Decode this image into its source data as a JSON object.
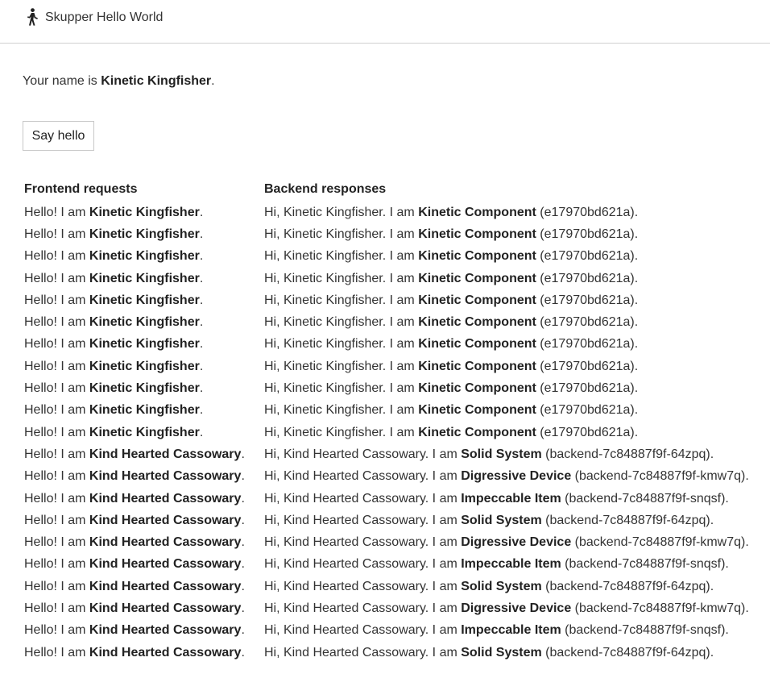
{
  "header": {
    "title": "Skupper Hello World",
    "logo_icon": "person-walking-icon"
  },
  "name_line": {
    "prefix": "Your name is ",
    "name": "Kinetic Kingfisher",
    "suffix": "."
  },
  "say_hello_label": "Say hello",
  "table": {
    "frontend_header": "Frontend requests",
    "backend_header": "Backend responses",
    "rows": [
      {
        "req_prefix": "Hello! I am ",
        "req_name": "Kinetic Kingfisher",
        "req_suffix": ".",
        "res_prefix": "Hi, Kinetic Kingfisher. I am ",
        "res_name": "Kinetic Component",
        "res_suffix": " (e17970bd621a)."
      },
      {
        "req_prefix": "Hello! I am ",
        "req_name": "Kinetic Kingfisher",
        "req_suffix": ".",
        "res_prefix": "Hi, Kinetic Kingfisher. I am ",
        "res_name": "Kinetic Component",
        "res_suffix": " (e17970bd621a)."
      },
      {
        "req_prefix": "Hello! I am ",
        "req_name": "Kinetic Kingfisher",
        "req_suffix": ".",
        "res_prefix": "Hi, Kinetic Kingfisher. I am ",
        "res_name": "Kinetic Component",
        "res_suffix": " (e17970bd621a)."
      },
      {
        "req_prefix": "Hello! I am ",
        "req_name": "Kinetic Kingfisher",
        "req_suffix": ".",
        "res_prefix": "Hi, Kinetic Kingfisher. I am ",
        "res_name": "Kinetic Component",
        "res_suffix": " (e17970bd621a)."
      },
      {
        "req_prefix": "Hello! I am ",
        "req_name": "Kinetic Kingfisher",
        "req_suffix": ".",
        "res_prefix": "Hi, Kinetic Kingfisher. I am ",
        "res_name": "Kinetic Component",
        "res_suffix": " (e17970bd621a)."
      },
      {
        "req_prefix": "Hello! I am ",
        "req_name": "Kinetic Kingfisher",
        "req_suffix": ".",
        "res_prefix": "Hi, Kinetic Kingfisher. I am ",
        "res_name": "Kinetic Component",
        "res_suffix": " (e17970bd621a)."
      },
      {
        "req_prefix": "Hello! I am ",
        "req_name": "Kinetic Kingfisher",
        "req_suffix": ".",
        "res_prefix": "Hi, Kinetic Kingfisher. I am ",
        "res_name": "Kinetic Component",
        "res_suffix": " (e17970bd621a)."
      },
      {
        "req_prefix": "Hello! I am ",
        "req_name": "Kinetic Kingfisher",
        "req_suffix": ".",
        "res_prefix": "Hi, Kinetic Kingfisher. I am ",
        "res_name": "Kinetic Component",
        "res_suffix": " (e17970bd621a)."
      },
      {
        "req_prefix": "Hello! I am ",
        "req_name": "Kinetic Kingfisher",
        "req_suffix": ".",
        "res_prefix": "Hi, Kinetic Kingfisher. I am ",
        "res_name": "Kinetic Component",
        "res_suffix": " (e17970bd621a)."
      },
      {
        "req_prefix": "Hello! I am ",
        "req_name": "Kinetic Kingfisher",
        "req_suffix": ".",
        "res_prefix": "Hi, Kinetic Kingfisher. I am ",
        "res_name": "Kinetic Component",
        "res_suffix": " (e17970bd621a)."
      },
      {
        "req_prefix": "Hello! I am ",
        "req_name": "Kinetic Kingfisher",
        "req_suffix": ".",
        "res_prefix": "Hi, Kinetic Kingfisher. I am ",
        "res_name": "Kinetic Component",
        "res_suffix": " (e17970bd621a)."
      },
      {
        "req_prefix": "Hello! I am ",
        "req_name": "Kind Hearted Cassowary",
        "req_suffix": ".",
        "res_prefix": "Hi, Kind Hearted Cassowary. I am ",
        "res_name": "Solid System",
        "res_suffix": " (backend-7c84887f9f-64zpq)."
      },
      {
        "req_prefix": "Hello! I am ",
        "req_name": "Kind Hearted Cassowary",
        "req_suffix": ".",
        "res_prefix": "Hi, Kind Hearted Cassowary. I am ",
        "res_name": "Digressive Device",
        "res_suffix": " (backend-7c84887f9f-kmw7q)."
      },
      {
        "req_prefix": "Hello! I am ",
        "req_name": "Kind Hearted Cassowary",
        "req_suffix": ".",
        "res_prefix": "Hi, Kind Hearted Cassowary. I am ",
        "res_name": "Impeccable Item",
        "res_suffix": " (backend-7c84887f9f-snqsf)."
      },
      {
        "req_prefix": "Hello! I am ",
        "req_name": "Kind Hearted Cassowary",
        "req_suffix": ".",
        "res_prefix": "Hi, Kind Hearted Cassowary. I am ",
        "res_name": "Solid System",
        "res_suffix": " (backend-7c84887f9f-64zpq)."
      },
      {
        "req_prefix": "Hello! I am ",
        "req_name": "Kind Hearted Cassowary",
        "req_suffix": ".",
        "res_prefix": "Hi, Kind Hearted Cassowary. I am ",
        "res_name": "Digressive Device",
        "res_suffix": " (backend-7c84887f9f-kmw7q)."
      },
      {
        "req_prefix": "Hello! I am ",
        "req_name": "Kind Hearted Cassowary",
        "req_suffix": ".",
        "res_prefix": "Hi, Kind Hearted Cassowary. I am ",
        "res_name": "Impeccable Item",
        "res_suffix": " (backend-7c84887f9f-snqsf)."
      },
      {
        "req_prefix": "Hello! I am ",
        "req_name": "Kind Hearted Cassowary",
        "req_suffix": ".",
        "res_prefix": "Hi, Kind Hearted Cassowary. I am ",
        "res_name": "Solid System",
        "res_suffix": " (backend-7c84887f9f-64zpq)."
      },
      {
        "req_prefix": "Hello! I am ",
        "req_name": "Kind Hearted Cassowary",
        "req_suffix": ".",
        "res_prefix": "Hi, Kind Hearted Cassowary. I am ",
        "res_name": "Digressive Device",
        "res_suffix": " (backend-7c84887f9f-kmw7q)."
      },
      {
        "req_prefix": "Hello! I am ",
        "req_name": "Kind Hearted Cassowary",
        "req_suffix": ".",
        "res_prefix": "Hi, Kind Hearted Cassowary. I am ",
        "res_name": "Impeccable Item",
        "res_suffix": " (backend-7c84887f9f-snqsf)."
      },
      {
        "req_prefix": "Hello! I am ",
        "req_name": "Kind Hearted Cassowary",
        "req_suffix": ".",
        "res_prefix": "Hi, Kind Hearted Cassowary. I am ",
        "res_name": "Solid System",
        "res_suffix": " (backend-7c84887f9f-64zpq)."
      }
    ]
  }
}
